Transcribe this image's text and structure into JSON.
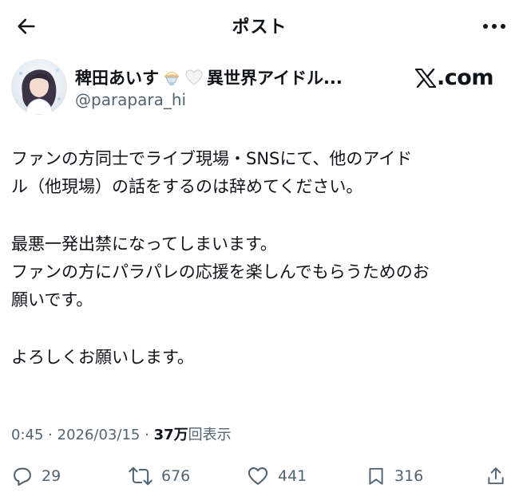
{
  "header": {
    "title": "ポスト",
    "back_icon": "arrow-left-icon",
    "more_icon": "more-horizontal-icon"
  },
  "author": {
    "display_name": "稗田あいす",
    "name_suffix": "異世界アイドル...",
    "emoji_1": "shaved-ice-emoji",
    "emoji_2": "white-heart-emoji",
    "handle": "@parapara_hi",
    "source_label": "X.com"
  },
  "tweet": {
    "paragraphs": [
      [
        "ファンの方同士でライブ現場・SNSにて、他のアイド",
        "ル（他現場）の話をするのは辞めてください。"
      ],
      [
        "最悪一発出禁になってしまいます。",
        "ファンの方にパラパレの応援を楽しんでもらうためのお",
        "願いです。"
      ],
      [
        "よろしくお願いします。"
      ]
    ]
  },
  "meta": {
    "time": "0:45",
    "separator": "·",
    "date": "2026/03/15",
    "views_count": "37万",
    "views_label": "回表示"
  },
  "actions": {
    "reply": {
      "icon": "reply-icon",
      "count": "29"
    },
    "repost": {
      "icon": "repost-icon",
      "count": "676"
    },
    "like": {
      "icon": "heart-icon",
      "count": "441"
    },
    "bookmark": {
      "icon": "bookmark-icon",
      "count": "316"
    },
    "share": {
      "icon": "share-icon"
    }
  }
}
